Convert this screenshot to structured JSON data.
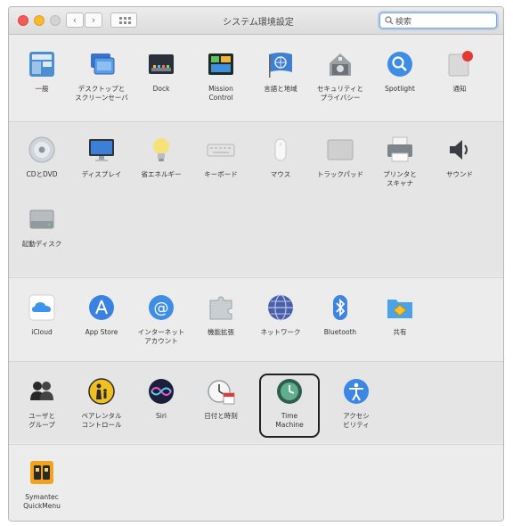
{
  "window": {
    "title": "システム環境設定",
    "search": {
      "value": "検索",
      "placeholder": "検索"
    },
    "nav": {
      "back_icon": "chevron-left-icon",
      "forward_icon": "chevron-right-icon",
      "grid_icon": "grid-icon"
    }
  },
  "sections": [
    {
      "items": [
        {
          "label": "一般",
          "icon": "general-icon"
        },
        {
          "label": "デスクトップと\nスクリーンセーバ",
          "icon": "desktop-screensaver-icon"
        },
        {
          "label": "Dock",
          "icon": "dock-icon"
        },
        {
          "label": "Mission\nControl",
          "icon": "mission-control-icon"
        },
        {
          "label": "言語と地域",
          "icon": "language-region-icon"
        },
        {
          "label": "セキュリティと\nプライバシー",
          "icon": "security-icon"
        },
        {
          "label": "Spotlight",
          "icon": "spotlight-icon"
        },
        {
          "label": "通知",
          "icon": "notifications-icon"
        }
      ]
    },
    {
      "items": [
        {
          "label": "CDとDVD",
          "icon": "cd-dvd-icon"
        },
        {
          "label": "ディスプレイ",
          "icon": "display-icon"
        },
        {
          "label": "省エネルギー",
          "icon": "energy-saver-icon"
        },
        {
          "label": "キーボード",
          "icon": "keyboard-icon"
        },
        {
          "label": "マウス",
          "icon": "mouse-icon"
        },
        {
          "label": "トラックパッド",
          "icon": "trackpad-icon"
        },
        {
          "label": "プリンタと\nスキャナ",
          "icon": "printer-icon"
        },
        {
          "label": "サウンド",
          "icon": "sound-icon"
        },
        {
          "label": "起動ディスク",
          "icon": "startup-disk-icon"
        }
      ]
    },
    {
      "items": [
        {
          "label": "iCloud",
          "icon": "icloud-icon"
        },
        {
          "label": "App Store",
          "icon": "app-store-icon"
        },
        {
          "label": "インターネット\nアカウント",
          "icon": "internet-accounts-icon"
        },
        {
          "label": "機能拡張",
          "icon": "extensions-icon"
        },
        {
          "label": "ネットワーク",
          "icon": "network-icon"
        },
        {
          "label": "Bluetooth",
          "icon": "bluetooth-icon"
        },
        {
          "label": "共有",
          "icon": "sharing-icon"
        }
      ]
    },
    {
      "items": [
        {
          "label": "ユーザと\nグループ",
          "icon": "users-groups-icon"
        },
        {
          "label": "ペアレンタル\nコントロール",
          "icon": "parental-controls-icon"
        },
        {
          "label": "Siri",
          "icon": "siri-icon"
        },
        {
          "label": "日付と時刻",
          "icon": "date-time-icon"
        },
        {
          "label": "Time\nMachine",
          "icon": "time-machine-icon",
          "selected": true
        },
        {
          "label": "アクセシ\nビリティ",
          "icon": "accessibility-icon"
        }
      ]
    },
    {
      "items": [
        {
          "label": "Symantec\nQuickMenu",
          "icon": "symantec-quickmenu-icon"
        }
      ]
    }
  ],
  "colors": {
    "accent": "#3b8ff5",
    "close": "#f45b55",
    "minimize": "#f7ba2f",
    "badge": "#e53935"
  }
}
